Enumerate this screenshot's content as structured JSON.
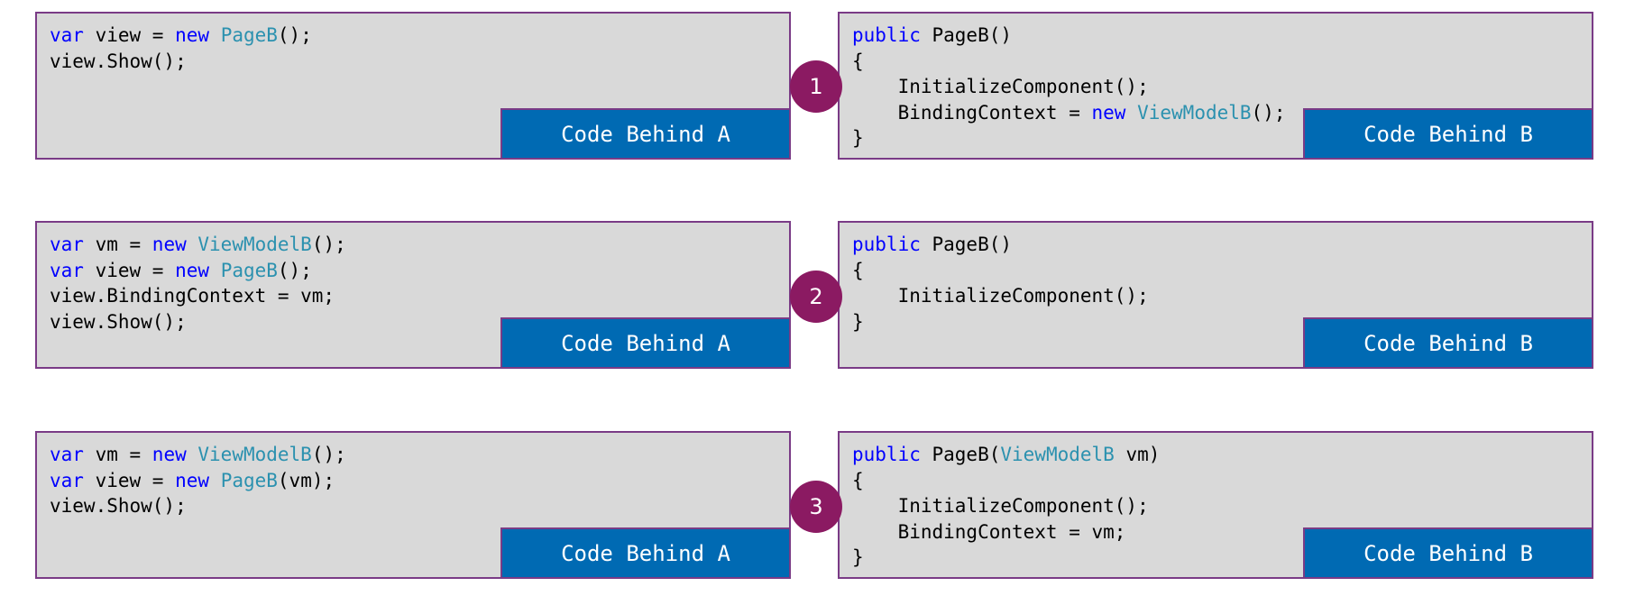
{
  "colors": {
    "panel_bg": "#d9d9d9",
    "panel_border": "#7a3b86",
    "label_bg": "#006ab3",
    "step_badge": "#8b1a62",
    "keyword": "#0000ff",
    "type": "#2b91af"
  },
  "rows": [
    {
      "step": "1",
      "left": {
        "label": "Code Behind A",
        "lines": [
          [
            {
              "t": "var",
              "c": "kw"
            },
            {
              "t": " view = "
            },
            {
              "t": "new",
              "c": "kw"
            },
            {
              "t": " "
            },
            {
              "t": "PageB",
              "c": "ty"
            },
            {
              "t": "();"
            }
          ],
          [
            {
              "t": "view.Show();"
            }
          ]
        ]
      },
      "right": {
        "label": "Code Behind B",
        "lines": [
          [
            {
              "t": "public",
              "c": "kw"
            },
            {
              "t": " PageB()"
            }
          ],
          [
            {
              "t": "{"
            }
          ],
          [
            {
              "t": "    InitializeComponent();"
            }
          ],
          [
            {
              "t": "    BindingContext = "
            },
            {
              "t": "new",
              "c": "kw"
            },
            {
              "t": " "
            },
            {
              "t": "ViewModelB",
              "c": "ty"
            },
            {
              "t": "();"
            }
          ],
          [
            {
              "t": "}"
            }
          ]
        ]
      }
    },
    {
      "step": "2",
      "left": {
        "label": "Code Behind A",
        "lines": [
          [
            {
              "t": "var",
              "c": "kw"
            },
            {
              "t": " vm = "
            },
            {
              "t": "new",
              "c": "kw"
            },
            {
              "t": " "
            },
            {
              "t": "ViewModelB",
              "c": "ty"
            },
            {
              "t": "();"
            }
          ],
          [
            {
              "t": "var",
              "c": "kw"
            },
            {
              "t": " view = "
            },
            {
              "t": "new",
              "c": "kw"
            },
            {
              "t": " "
            },
            {
              "t": "PageB",
              "c": "ty"
            },
            {
              "t": "();"
            }
          ],
          [
            {
              "t": "view.BindingContext = vm;"
            }
          ],
          [
            {
              "t": "view.Show();"
            }
          ]
        ]
      },
      "right": {
        "label": "Code Behind B",
        "lines": [
          [
            {
              "t": "public",
              "c": "kw"
            },
            {
              "t": " PageB()"
            }
          ],
          [
            {
              "t": "{"
            }
          ],
          [
            {
              "t": "    InitializeComponent();"
            }
          ],
          [
            {
              "t": "}"
            }
          ]
        ]
      }
    },
    {
      "step": "3",
      "left": {
        "label": "Code Behind A",
        "lines": [
          [
            {
              "t": "var",
              "c": "kw"
            },
            {
              "t": " vm = "
            },
            {
              "t": "new",
              "c": "kw"
            },
            {
              "t": " "
            },
            {
              "t": "ViewModelB",
              "c": "ty"
            },
            {
              "t": "();"
            }
          ],
          [
            {
              "t": "var",
              "c": "kw"
            },
            {
              "t": " view = "
            },
            {
              "t": "new",
              "c": "kw"
            },
            {
              "t": " "
            },
            {
              "t": "PageB",
              "c": "ty"
            },
            {
              "t": "(vm);"
            }
          ],
          [
            {
              "t": "view.Show();"
            }
          ]
        ]
      },
      "right": {
        "label": "Code Behind B",
        "lines": [
          [
            {
              "t": "public",
              "c": "kw"
            },
            {
              "t": " PageB("
            },
            {
              "t": "ViewModelB",
              "c": "ty"
            },
            {
              "t": " vm)"
            }
          ],
          [
            {
              "t": "{"
            }
          ],
          [
            {
              "t": "    InitializeComponent();"
            }
          ],
          [
            {
              "t": "    BindingContext = vm;"
            }
          ],
          [
            {
              "t": "}"
            }
          ]
        ]
      }
    }
  ]
}
